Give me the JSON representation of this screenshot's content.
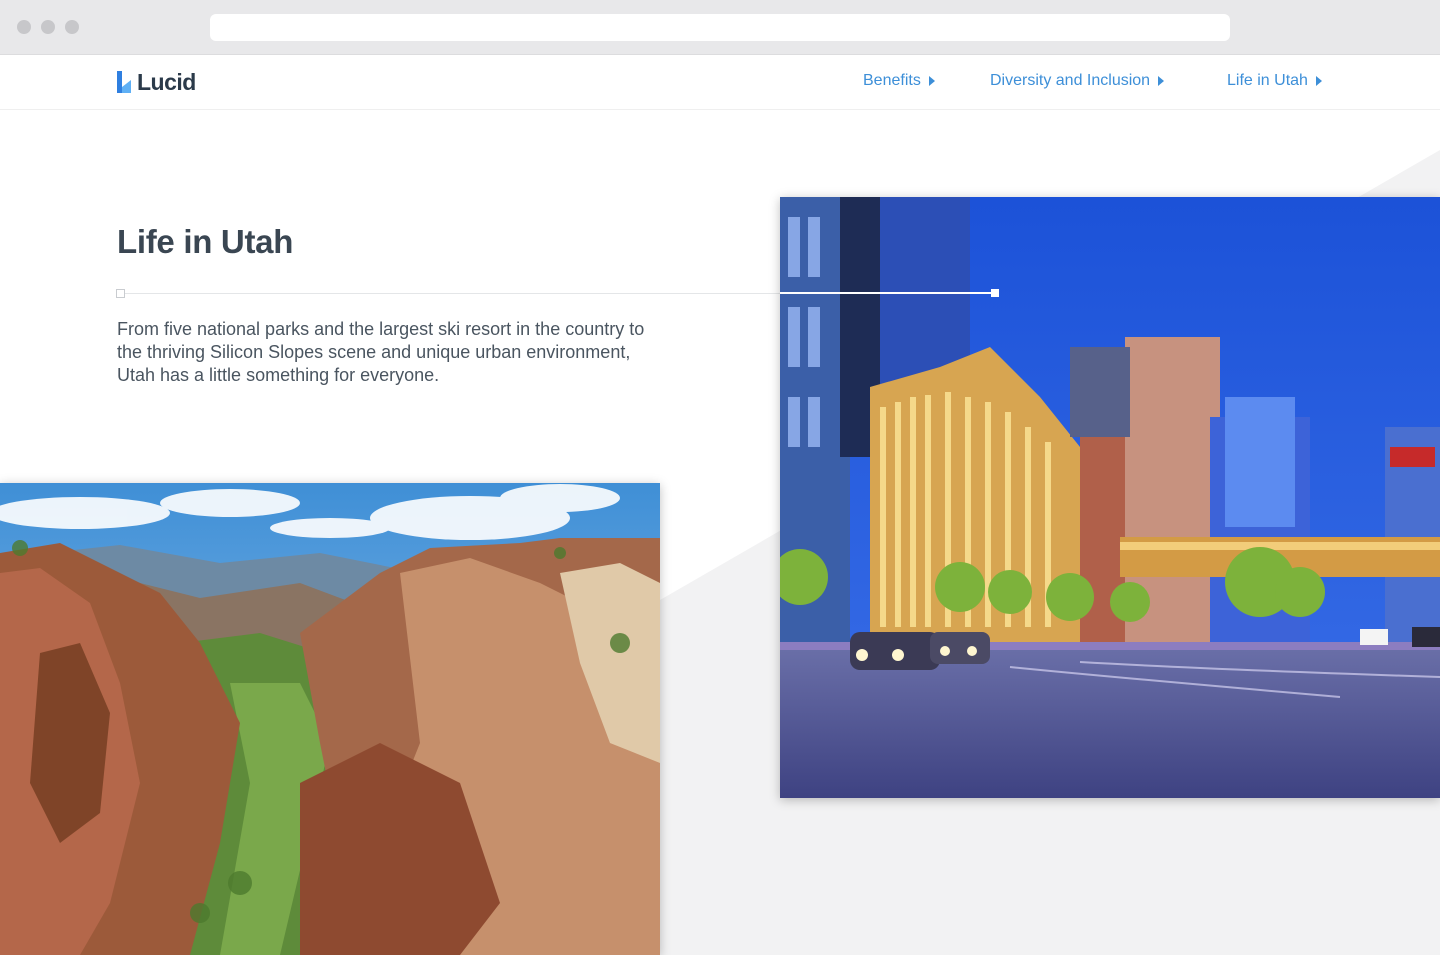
{
  "brand": {
    "name": "Lucid",
    "accent": "#3d8fd8",
    "logo_icon": "lucid-logo-icon"
  },
  "nav": {
    "items": [
      {
        "label": "Benefits",
        "icon": "caret-right-icon"
      },
      {
        "label": "Diversity and Inclusion",
        "icon": "caret-right-icon"
      },
      {
        "label": "Life in Utah",
        "icon": "caret-right-icon"
      }
    ]
  },
  "section": {
    "title": "Life in Utah",
    "description": "From five national parks and the largest ski resort in the country to the thriving Silicon Slopes scene and unique urban environment, Utah has a little something for everyone."
  },
  "images": {
    "canyon": "canyon-landscape-photo",
    "city": "city-street-night-photo"
  }
}
